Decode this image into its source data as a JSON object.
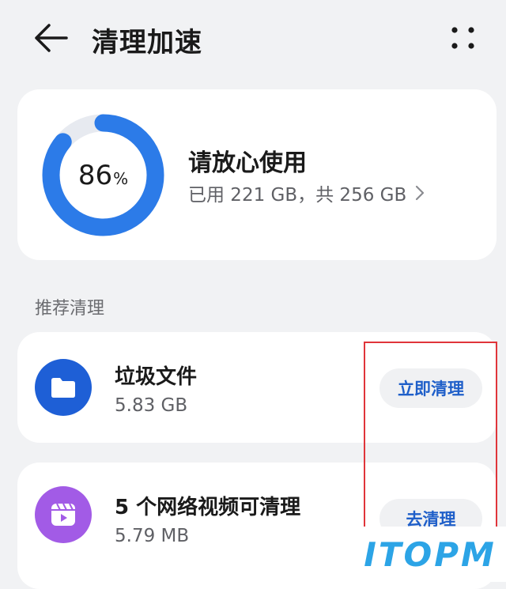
{
  "header": {
    "title": "清理加速"
  },
  "storage": {
    "percent": "86",
    "percent_sign": "%",
    "used_fraction": 0.86,
    "status_title": "请放心使用",
    "usage_text": "已用 221 GB，共 256 GB",
    "ring_color": "#2c7be8"
  },
  "section": {
    "title": "推荐清理"
  },
  "items": [
    {
      "title": "垃圾文件",
      "size": "5.83 GB",
      "action": "立即清理",
      "icon": "folder-icon",
      "icon_color": "#1e5fd6"
    },
    {
      "title": "5 个网络视频可清理",
      "size": "5.79 MB",
      "action": "去清理",
      "icon": "video-icon",
      "icon_color": "#a25be6"
    }
  ],
  "watermark": {
    "text": "ITOPM"
  }
}
